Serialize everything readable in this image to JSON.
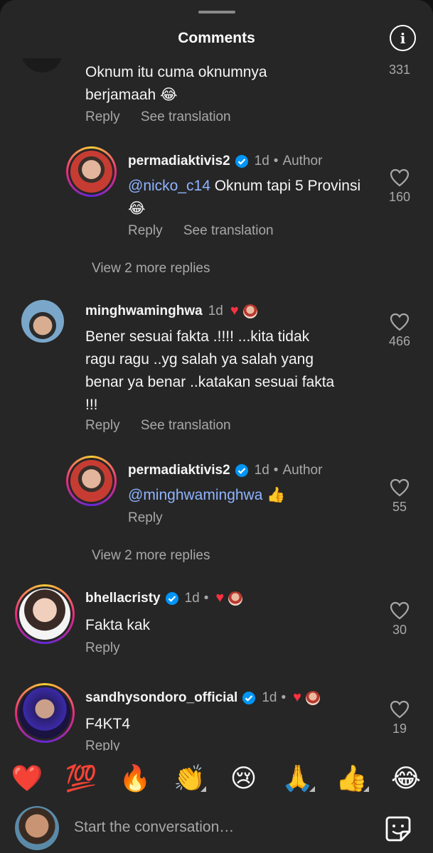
{
  "header": {
    "title": "Comments"
  },
  "comments": [
    {
      "text": "Oknum itu cuma oknumnya berjamaah 😂",
      "reply": "Reply",
      "translate": "See translation",
      "likes": "331"
    },
    {
      "username": "permadiaktivis2",
      "time": "1d",
      "author": "Author",
      "mention": "@nicko_c14",
      "text": " Oknum tapi 5 Provinsi 😂",
      "reply": "Reply",
      "translate": "See translation",
      "likes": "160"
    },
    {
      "more": "View 2 more replies"
    },
    {
      "username": "minghwaminghwa",
      "time": "1d",
      "text": "Bener sesuai fakta .!!!! ...kita tidak ragu ragu ..yg salah ya salah yang benar ya benar ..katakan sesuai fakta !!!",
      "reply": "Reply",
      "translate": "See translation",
      "likes": "466"
    },
    {
      "username": "permadiaktivis2",
      "time": "1d",
      "author": "Author",
      "mention": "@minghwaminghwa",
      "text": " 👍",
      "reply": "Reply",
      "likes": "55"
    },
    {
      "more": "View 2 more replies"
    },
    {
      "username": "bhellacristy",
      "time": "1d",
      "text": "Fakta kak",
      "reply": "Reply",
      "likes": "30"
    },
    {
      "username": "sandhysondoro_official",
      "time": "1d",
      "text": "F4KT4",
      "reply": "Reply",
      "likes": "19"
    }
  ],
  "reactions": [
    "❤️",
    "💯",
    "🔥",
    "👏",
    "😢",
    "🙏",
    "👍",
    "😂"
  ],
  "composer": {
    "placeholder": "Start the conversation…"
  },
  "colors": {
    "sheet": "#262626",
    "heart_red": "#ff3040",
    "verified_blue": "#0095f6",
    "link": "#8fb4ff"
  },
  "icons": [
    "info-icon",
    "heart-outline-icon",
    "verified-icon",
    "sticker-icon"
  ]
}
